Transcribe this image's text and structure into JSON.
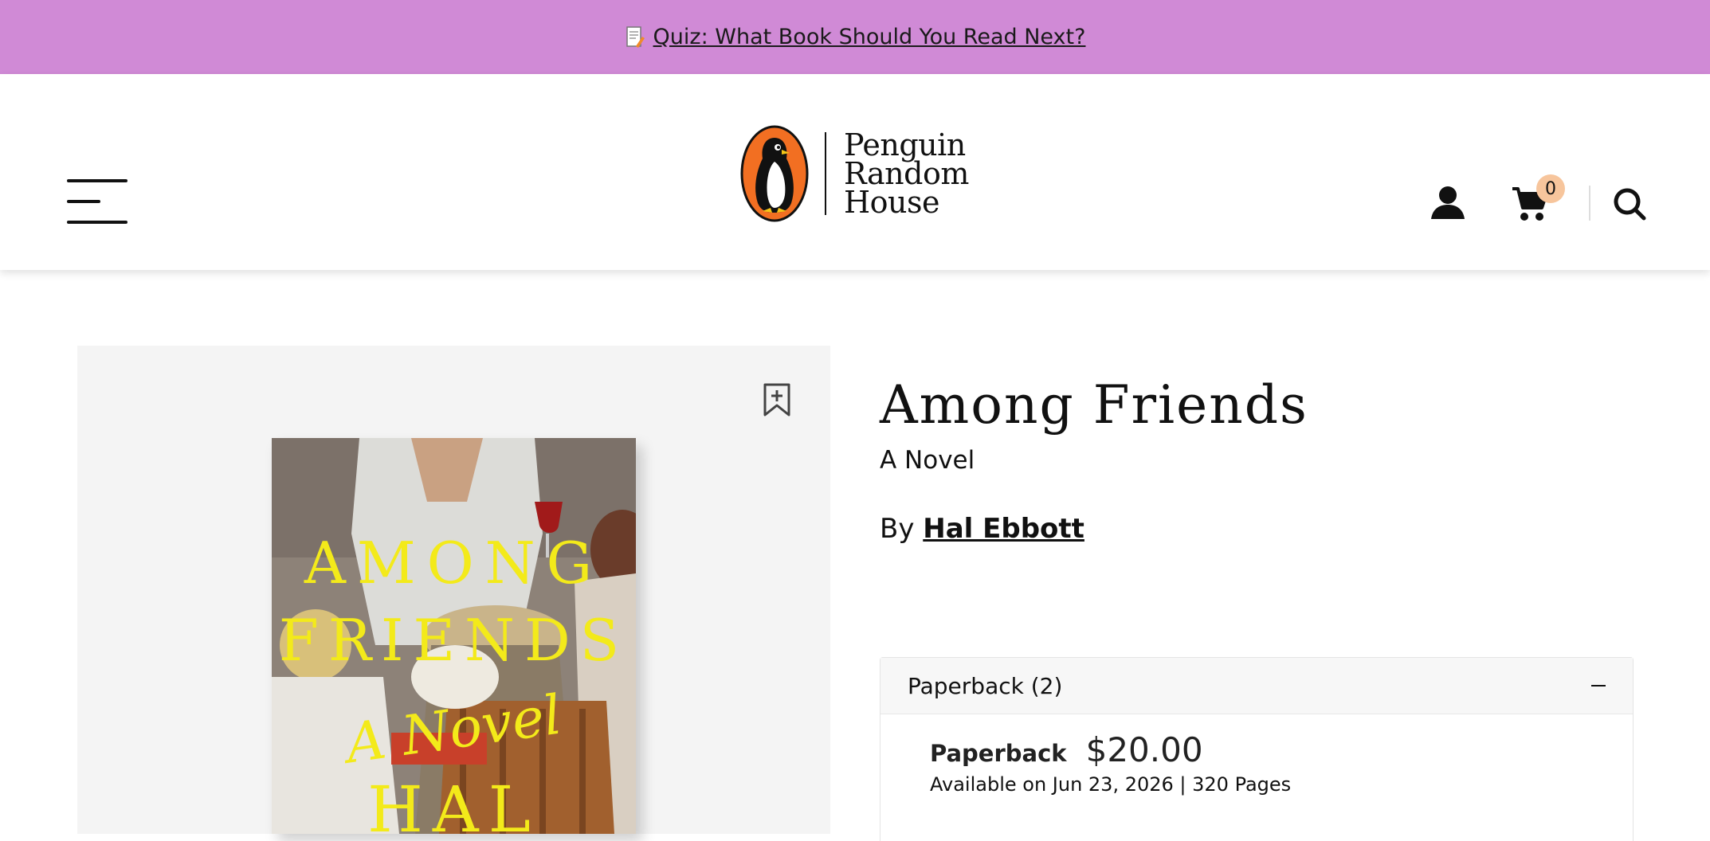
{
  "promo": {
    "text": "Quiz: What Book Should You Read Next?",
    "icon": "quiz-notepad-icon"
  },
  "header": {
    "logo_lines": [
      "Penguin",
      "Random",
      "House"
    ],
    "cart_count": "0",
    "icons": [
      "menu-icon",
      "user-icon",
      "cart-icon",
      "search-icon"
    ]
  },
  "book": {
    "title": "Among Friends",
    "subtitle": "A Novel",
    "by_label": "By",
    "author": "Hal Ebbott",
    "cover_lines": [
      "AMONG",
      "FRIENDS",
      "A Novel",
      "HAL"
    ]
  },
  "formats": {
    "group_label": "Paperback (2)",
    "selected_format": "Paperback",
    "price": "$20.00",
    "availability": "Available on Jun 23, 2026 | 320 Pages"
  },
  "colors": {
    "promo_bg": "#d08ad6",
    "cover_text": "#f3ea1a",
    "badge_bg": "#f7c59c",
    "panel_bg": "#f4f4f4"
  }
}
